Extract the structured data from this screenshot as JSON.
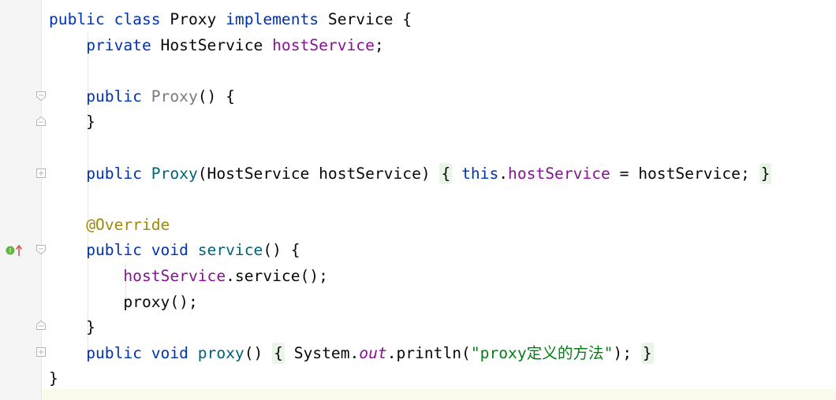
{
  "editor": {
    "lines": [
      {
        "parts": [
          [
            "kw",
            "public"
          ],
          [
            "",
            " "
          ],
          [
            "kw",
            "class"
          ],
          [
            "",
            " Proxy "
          ],
          [
            "kw",
            "implements"
          ],
          [
            "",
            " Service {"
          ]
        ]
      },
      {
        "parts": [
          [
            "",
            "    "
          ],
          [
            "kw",
            "private"
          ],
          [
            "",
            " HostService "
          ],
          [
            "fld",
            "hostService"
          ],
          [
            "",
            ";"
          ]
        ]
      },
      {
        "parts": []
      },
      {
        "parts": [
          [
            "",
            "    "
          ],
          [
            "kw",
            "public"
          ],
          [
            "",
            " "
          ],
          [
            "cls-dim",
            "Proxy"
          ],
          [
            "",
            "() {"
          ]
        ]
      },
      {
        "parts": [
          [
            "",
            "    }"
          ]
        ]
      },
      {
        "parts": []
      },
      {
        "parts": [
          [
            "",
            "    "
          ],
          [
            "kw",
            "public"
          ],
          [
            "",
            " "
          ],
          [
            "fn",
            "Proxy"
          ],
          [
            "",
            "(HostService hostService) "
          ],
          [
            "fold",
            "{"
          ],
          [
            "",
            " "
          ],
          [
            "kw",
            "this"
          ],
          [
            "",
            "."
          ],
          [
            "fld",
            "hostService"
          ],
          [
            "",
            " = hostService; "
          ],
          [
            "fold",
            "}"
          ]
        ]
      },
      {
        "parts": []
      },
      {
        "parts": [
          [
            "",
            "    "
          ],
          [
            "ann",
            "@Override"
          ]
        ]
      },
      {
        "parts": [
          [
            "",
            "    "
          ],
          [
            "kw",
            "public"
          ],
          [
            "",
            " "
          ],
          [
            "kw",
            "void"
          ],
          [
            "",
            " "
          ],
          [
            "fn",
            "service"
          ],
          [
            "",
            "() {"
          ]
        ]
      },
      {
        "parts": [
          [
            "",
            "        "
          ],
          [
            "fld",
            "hostService"
          ],
          [
            "",
            ".service();"
          ]
        ]
      },
      {
        "parts": [
          [
            "",
            "        proxy();"
          ]
        ]
      },
      {
        "parts": [
          [
            "",
            "    }"
          ]
        ]
      },
      {
        "parts": [
          [
            "",
            "    "
          ],
          [
            "kw",
            "public"
          ],
          [
            "",
            " "
          ],
          [
            "kw",
            "void"
          ],
          [
            "",
            " "
          ],
          [
            "fn",
            "proxy"
          ],
          [
            "",
            "() "
          ],
          [
            "fold",
            "{"
          ],
          [
            "",
            " System."
          ],
          [
            "itl",
            "out"
          ],
          [
            "",
            ".println("
          ],
          [
            "str",
            "\"proxy定义的方法\""
          ],
          [
            "",
            "); "
          ],
          [
            "fold",
            "}"
          ]
        ]
      },
      {
        "parts": [
          [
            "",
            "}"
          ]
        ]
      }
    ]
  }
}
